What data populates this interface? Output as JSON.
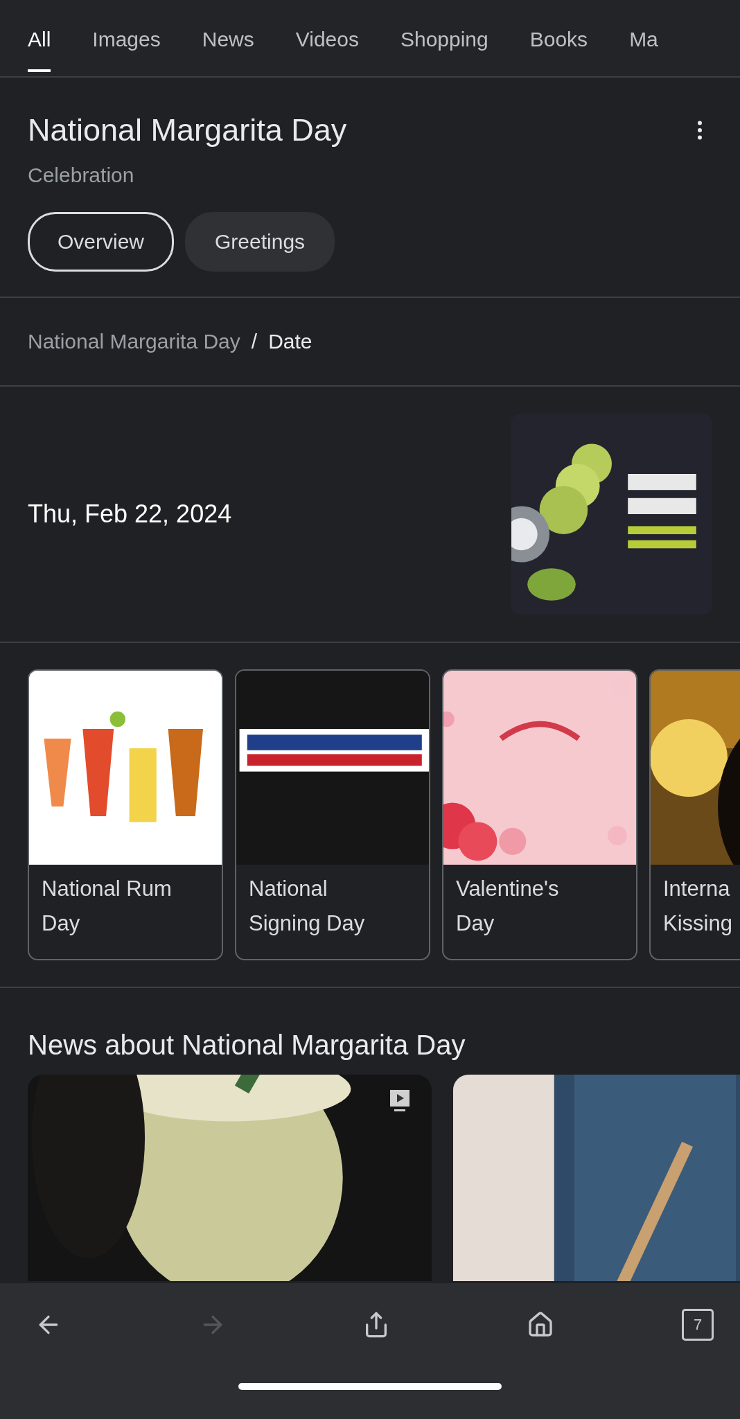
{
  "tabs": [
    {
      "label": "All",
      "selected": true
    },
    {
      "label": "Images",
      "selected": false
    },
    {
      "label": "News",
      "selected": false
    },
    {
      "label": "Videos",
      "selected": false
    },
    {
      "label": "Shopping",
      "selected": false
    },
    {
      "label": "Books",
      "selected": false
    },
    {
      "label": "Ma",
      "selected": false
    }
  ],
  "header": {
    "title": "National Margarita Day",
    "subtitle": "Celebration",
    "chips": [
      {
        "label": "Overview",
        "selected": true
      },
      {
        "label": "Greetings",
        "selected": false
      }
    ]
  },
  "breadcrumb": {
    "parent": "National Margarita Day",
    "separator": "/",
    "current": "Date"
  },
  "answer": {
    "date": "Thu, Feb 22, 2024"
  },
  "related": [
    {
      "title": "National Rum Day"
    },
    {
      "title": "National Signing Day"
    },
    {
      "title": "Valentine's Day"
    },
    {
      "title": "Interna Kissing"
    }
  ],
  "news": {
    "heading": "News about National Margarita Day",
    "items": [
      {
        "video": true
      },
      {
        "video": false
      }
    ]
  },
  "bottom_bar": [
    {
      "kind": "back",
      "disabled": false
    },
    {
      "kind": "forward",
      "disabled": true
    },
    {
      "kind": "share",
      "disabled": false
    },
    {
      "kind": "home",
      "disabled": false
    },
    {
      "kind": "tabs",
      "disabled": false,
      "count": "7"
    }
  ]
}
